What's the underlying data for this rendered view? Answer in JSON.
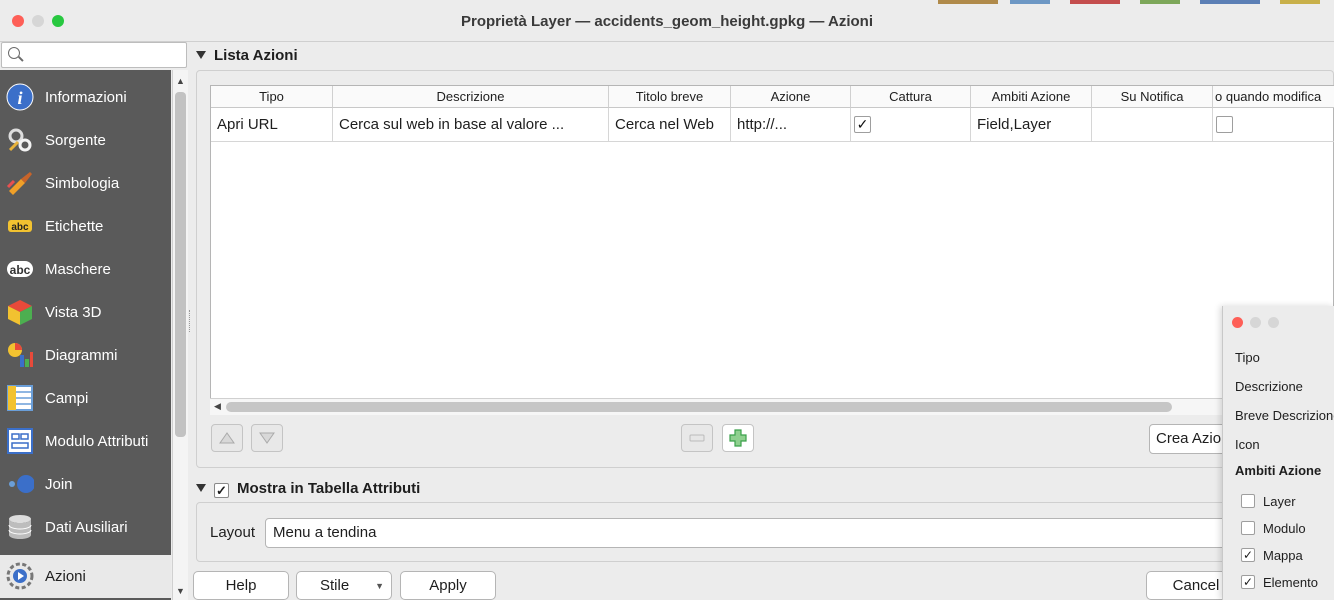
{
  "window": {
    "title": "Proprietà Layer — accidents_geom_height.gpkg — Azioni"
  },
  "search": {
    "placeholder": ""
  },
  "sidebar": {
    "items": [
      {
        "label": "Informazioni",
        "icon": "info-icon"
      },
      {
        "label": "Sorgente",
        "icon": "source-icon"
      },
      {
        "label": "Simbologia",
        "icon": "symbology-icon"
      },
      {
        "label": "Etichette",
        "icon": "labels-icon"
      },
      {
        "label": "Maschere",
        "icon": "masks-icon"
      },
      {
        "label": "Vista 3D",
        "icon": "3d-view-icon"
      },
      {
        "label": "Diagrammi",
        "icon": "diagrams-icon"
      },
      {
        "label": "Campi",
        "icon": "fields-icon"
      },
      {
        "label": "Modulo Attributi",
        "icon": "attributes-form-icon"
      },
      {
        "label": "Join",
        "icon": "join-icon"
      },
      {
        "label": "Dati Ausiliari",
        "icon": "auxiliary-data-icon"
      },
      {
        "label": "Azioni",
        "icon": "actions-icon"
      }
    ]
  },
  "actions_section": {
    "title": "Lista Azioni",
    "columns": [
      "Tipo",
      "Descrizione",
      "Titolo breve",
      "Azione",
      "Cattura",
      "Ambiti Azione",
      "Su Notifica",
      "o quando modifica"
    ],
    "rows": [
      {
        "tipo": "Apri URL",
        "descrizione": "Cerca sul web in base al valore ...",
        "titolo_breve": "Cerca nel Web",
        "azione": "http://...",
        "cattura": true,
        "ambiti": "Field,Layer",
        "notifica": "",
        "modifica": false
      }
    ],
    "create_button": "Crea Azioni predefinite"
  },
  "attribute_table_section": {
    "title": "Mostra in Tabella Attributi",
    "checked": true,
    "layout_label": "Layout",
    "layout_value": "Menu a tendina"
  },
  "footer": {
    "help": "Help",
    "style": "Stile",
    "apply": "Apply",
    "cancel": "Cancel"
  },
  "popup": {
    "fields": [
      "Tipo",
      "Descrizione",
      "Breve Descrizione",
      "Icon"
    ],
    "scope_title": "Ambiti Azione",
    "scopes": [
      {
        "label": "Layer",
        "checked": false
      },
      {
        "label": "Modulo",
        "checked": false
      },
      {
        "label": "Mappa",
        "checked": true
      },
      {
        "label": "Elemento",
        "checked": true
      }
    ]
  },
  "colors": {
    "sidebar_bg": "#5a5a5a",
    "close": "#fe5f57",
    "minimize": "#d6d6d6",
    "zoom": "#28c840",
    "add_green": "#3aa14a"
  }
}
